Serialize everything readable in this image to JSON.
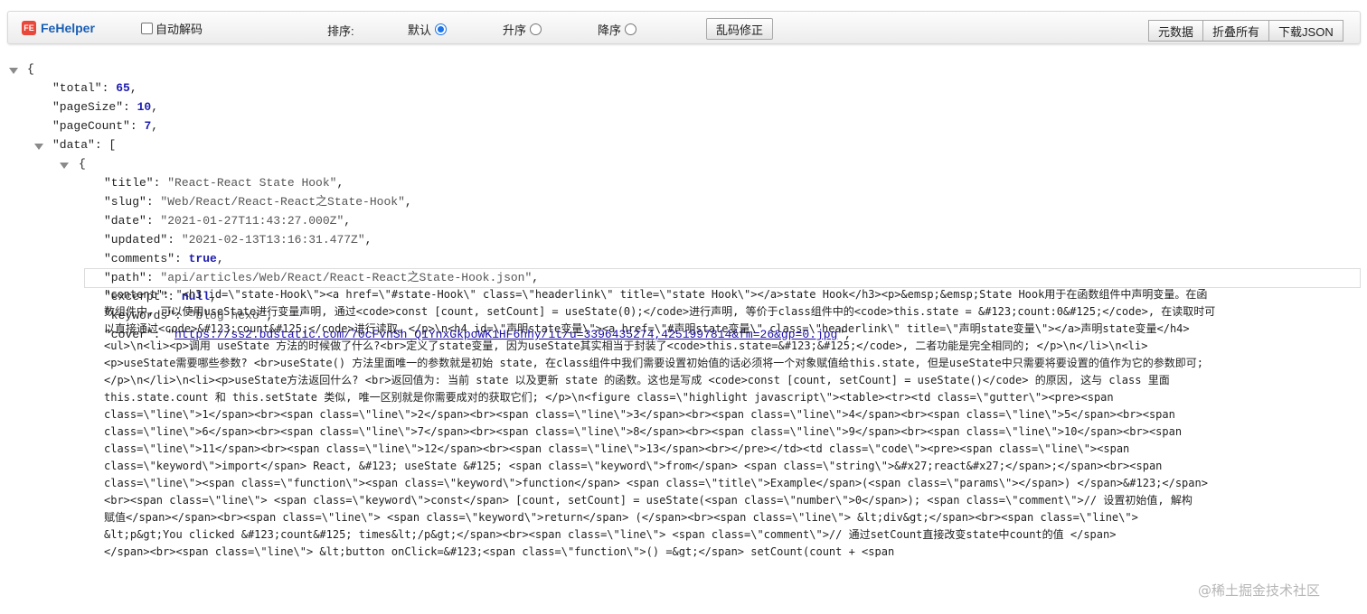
{
  "toolbar": {
    "brand": "FeHelper",
    "logo_badge": "FE",
    "auto_decode_label": "自动解码",
    "sort_label": "排序:",
    "sort_options": [
      {
        "label": "默认",
        "checked": true
      },
      {
        "label": "升序",
        "checked": false
      },
      {
        "label": "降序",
        "checked": false
      }
    ],
    "fix_button": "乱码修正",
    "right_buttons": [
      "元数据",
      "折叠所有",
      "下载JSON"
    ]
  },
  "json": {
    "open_brace": "{",
    "total_key": "\"total\"",
    "total_val": "65",
    "pageSize_key": "\"pageSize\"",
    "pageSize_val": "10",
    "pageCount_key": "\"pageCount\"",
    "pageCount_val": "7",
    "data_key": "\"data\"",
    "data_open": "[",
    "item_open": "{",
    "title_key": "\"title\"",
    "title_val": "\"React-React State Hook\"",
    "slug_key": "\"slug\"",
    "slug_val": "\"Web/React/React-React之State-Hook\"",
    "date_key": "\"date\"",
    "date_val": "\"2021-01-27T11:43:27.000Z\"",
    "updated_key": "\"updated\"",
    "updated_val": "\"2021-02-13T13:16:31.477Z\"",
    "comments_key": "\"comments\"",
    "comments_val": "true",
    "path_key": "\"path\"",
    "path_val": "\"api/articles/Web/React/React-React之State-Hook.json\"",
    "excerpt_key": "\"excerpt\"",
    "excerpt_val": "null",
    "keywords_key": "\"keywords\"",
    "keywords_val": "\"blog hexo\"",
    "cover_key": "\"cover\"",
    "cover_val": "https://ss2.bdstatic.com/70cFvnSh_Q1YnxGkpoWK1HF6hhy/it/u=3396435274,4251997814&fm=26&gp=0.jpg",
    "content_key": "\"content\""
  },
  "content_lines": [
    "\"<h3 id=\\\"state-Hook\\\"><a href=\\\"#state-Hook\\\" class=\\\"headerlink\\\" title=\\\"state Hook\\\"></a>state Hook</h3><p>&emsp;&emsp;State Hook用于在函数组件中声明变量。在函",
    "数组件中, 可以使用useState进行变量声明, 通过<code>const [count, setCount] = useState(0);</code>进行声明, 等价于class组件中的<code>this.state = &#123;count:0&#125;</code>, 在读取时可",
    "以直接通过<code>&#123;count&#125;</code>进行读取。</p>\\n<h4 id=\\\"声明state变量\\\"><a href=\\\"#声明state变量\\\" class=\\\"headerlink\\\" title=\\\"声明state变量\\\"></a>声明state变量</h4>",
    "<ul>\\n<li><p>调用 useState 方法的时候做了什么?<br>定义了state变量, 因为useState其实相当于封装了<code>this.state=&#123;&#125;</code>, 二者功能是完全相同的; </p>\\n</li>\\n<li>",
    "<p>useState需要哪些参数? <br>useState() 方法里面唯一的参数就是初始 state, 在class组件中我们需要设置初始值的话必须将一个对象赋值给this.state, 但是useState中只需要将要设置的值作为它的参数即可;",
    "</p>\\n</li>\\n<li><p>useState方法返回什么? <br>返回值为: 当前 state 以及更新 state 的函数。这也是写成 <code>const [count, setCount] = useState()</code> 的原因, 这与 class 里面",
    "this.state.count 和 this.setState 类似, 唯一区别就是你需要成对的获取它们; </p>\\n<figure class=\\\"highlight javascript\\\"><table><tr><td class=\\\"gutter\\\"><pre><span",
    "class=\\\"line\\\">1</span><br><span class=\\\"line\\\">2</span><br><span class=\\\"line\\\">3</span><br><span class=\\\"line\\\">4</span><br><span class=\\\"line\\\">5</span><br><span",
    "class=\\\"line\\\">6</span><br><span class=\\\"line\\\">7</span><br><span class=\\\"line\\\">8</span><br><span class=\\\"line\\\">9</span><br><span class=\\\"line\\\">10</span><br><span",
    "class=\\\"line\\\">11</span><br><span class=\\\"line\\\">12</span><br><span class=\\\"line\\\">13</span><br></pre></td><td class=\\\"code\\\"><pre><span class=\\\"line\\\"><span",
    "class=\\\"keyword\\\">import</span> React, &#123; useState &#125; <span class=\\\"keyword\\\">from</span> <span class=\\\"string\\\">&#x27;react&#x27;</span>;</span><br><span",
    "class=\\\"line\\\"><span class=\\\"function\\\"><span class=\\\"keyword\\\">function</span> <span class=\\\"title\\\">Example</span>(<span class=\\\"params\\\"></span>) </span>&#123;</span>",
    "<br><span class=\\\"line\\\">    <span class=\\\"keyword\\\">const</span> [count, setCount] = useState(<span class=\\\"number\\\">0</span>); <span class=\\\"comment\\\">// 设置初始值, 解构",
    "赋值</span></span><br><span class=\\\"line\\\">    <span class=\\\"keyword\\\">return</span> (</span><br><span class=\\\"line\\\">        &lt;div&gt;</span><br><span class=\\\"line\\\">",
    "&lt;p&gt;You clicked &#123;count&#125; times&lt;/p&gt;</span><br><span class=\\\"line\\\">            <span class=\\\"comment\\\">// 通过setCount直接改变state中count的值 </span>",
    "</span><br><span class=\\\"line\\\">            &lt;button onClick=&#123;<span class=\\\"function\\\">() =&gt;</span> setCount(count + <span"
  ],
  "watermark": "@稀土掘金技术社区"
}
